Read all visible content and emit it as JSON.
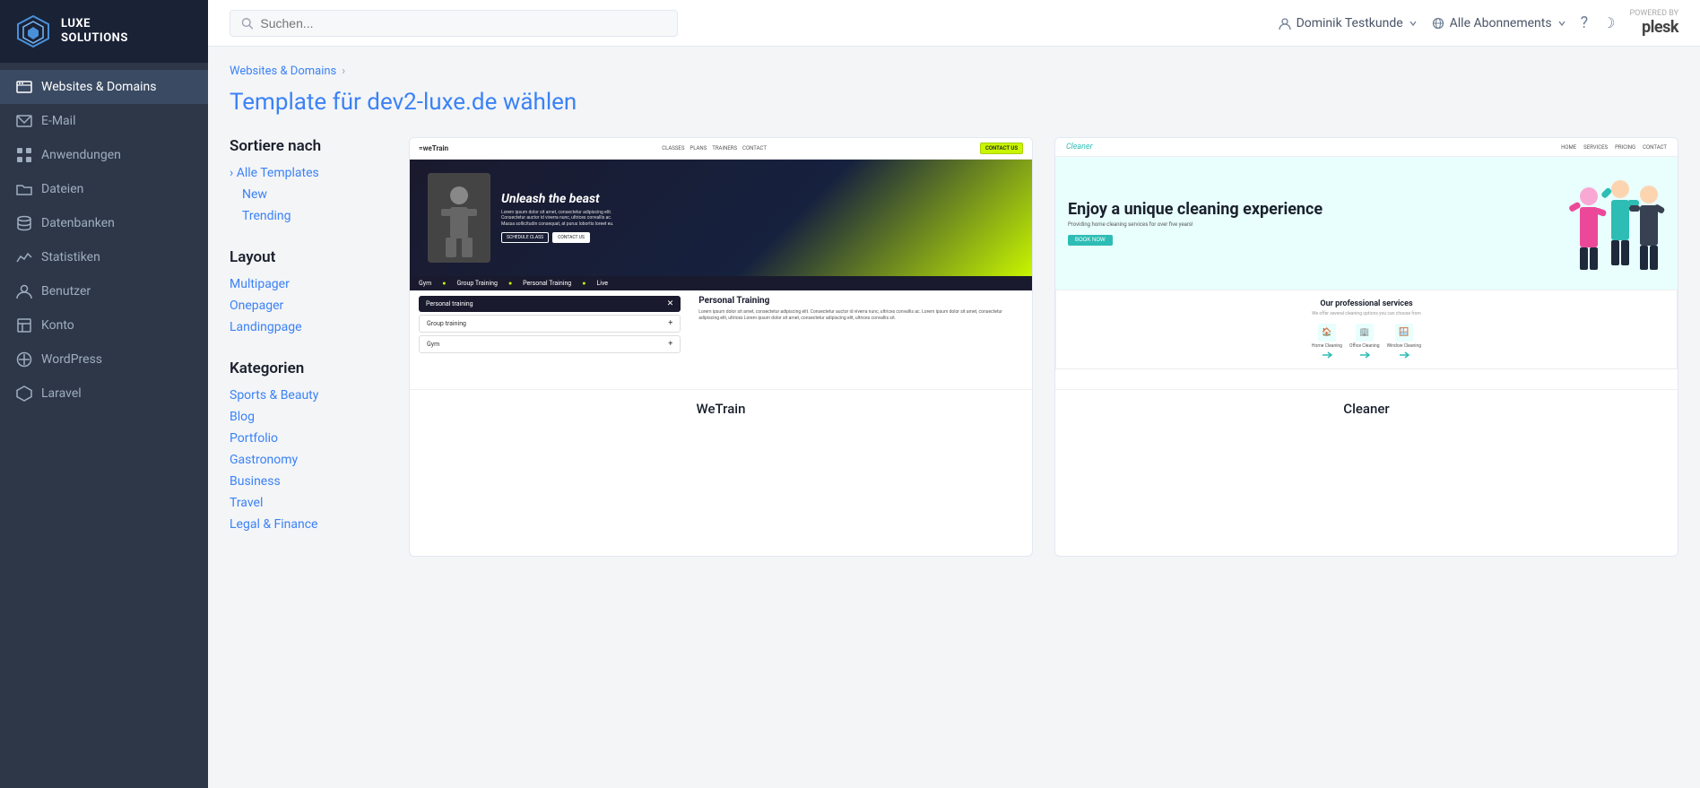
{
  "sidebar": {
    "logo_line1": "LUXE",
    "logo_line2": "SOLUTIONS",
    "items": [
      {
        "id": "websites",
        "label": "Websites & Domains",
        "icon": "globe",
        "active": true
      },
      {
        "id": "email",
        "label": "E-Mail",
        "icon": "envelope"
      },
      {
        "id": "applications",
        "label": "Anwendungen",
        "icon": "grid"
      },
      {
        "id": "files",
        "label": "Dateien",
        "icon": "folder"
      },
      {
        "id": "databases",
        "label": "Datenbanken",
        "icon": "database"
      },
      {
        "id": "statistics",
        "label": "Statistiken",
        "icon": "chart"
      },
      {
        "id": "users",
        "label": "Benutzer",
        "icon": "user"
      },
      {
        "id": "account",
        "label": "Konto",
        "icon": "building"
      },
      {
        "id": "wordpress",
        "label": "WordPress",
        "icon": "wordpress"
      },
      {
        "id": "laravel",
        "label": "Laravel",
        "icon": "laravel"
      }
    ]
  },
  "header": {
    "search_placeholder": "Suchen...",
    "user_name": "Dominik Testkunde",
    "subscription_label": "Alle Abonnements",
    "plesk_powered_by": "POWERED BY",
    "plesk_brand": "plesk"
  },
  "breadcrumb": {
    "parent": "Websites & Domains",
    "separator": "›"
  },
  "page": {
    "title_static": "Template für ",
    "title_domain": "dev2-luxe.de",
    "title_suffix": " wählen"
  },
  "filter": {
    "sort_title": "Sortiere nach",
    "all_templates_label": "Alle Templates",
    "new_label": "New",
    "trending_label": "Trending",
    "layout_title": "Layout",
    "layout_items": [
      "Multipager",
      "Onepager",
      "Landingpage"
    ],
    "categories_title": "Kategorien",
    "category_items": [
      "Sports & Beauty",
      "Blog",
      "Portfolio",
      "Gastronomy",
      "Business",
      "Travel",
      "Legal & Finance"
    ]
  },
  "templates": [
    {
      "id": "wetrain",
      "name": "WeTrain",
      "nav_logo": "=weTrain",
      "nav_links": [
        "CLASSES",
        "PLANS",
        "TRAINERS",
        "CONTACT"
      ],
      "nav_cta": "CONTACT US",
      "hero_title": "Unleash the beast",
      "hero_body": "Lorem ipsum dolor sit amet, consectetur adipiscing elit. Consectetur auctor id viverra nunc, ultrices convallis ac. Massa sollicitudin consequat, at purus lobortis loreet eu.",
      "hero_btn1": "SCHEDULE CLASS",
      "hero_btn2": "CONTACT US",
      "ticker_items": [
        "Gym",
        "Group Training",
        "Personal Training",
        "Live"
      ],
      "accordion_active": "Personal training",
      "accordion_items": [
        "Group training",
        "Gym"
      ],
      "right_title": "Personal Training",
      "right_body": "Lorem ipsum dolor sit amet, consectetur adipiscing elit. Consectetur auctor id viverra nunc, ultrices convallis ac. Lorem ipsum dolor sit amet, consectetur adipiscing elit, ultrices Lorem ipsum dolor sit amet, consectetur adipiscing elit, ultrices convallis sit."
    },
    {
      "id": "cleaner",
      "name": "Cleaner",
      "nav_logo": "Cleaner",
      "nav_links": [
        "HOME",
        "SERVICES",
        "PRICING",
        "CONTACT"
      ],
      "hero_title": "Enjoy a unique cleaning experience",
      "hero_sub": "Providing home cleaning services for over five years!",
      "hero_cta": "BOOK NOW",
      "services_title": "Our professional services",
      "services_sub": "We offer several cleaning options you can choose from",
      "services": [
        {
          "icon": "🏠",
          "name": "Home\nCleaning"
        },
        {
          "icon": "🏢",
          "name": "Office\nCleaning"
        },
        {
          "icon": "🪟",
          "name": "Window\nCleaning"
        }
      ]
    }
  ],
  "colors": {
    "sidebar_bg": "#2d3748",
    "sidebar_active": "#3a4a63",
    "sidebar_logo_bg": "#1a2236",
    "accent_blue": "#3b82f6",
    "wetrain_green": "#c8f500",
    "wetrain_dark": "#1a1a2e",
    "cleaner_teal": "#2dbdb4",
    "cleaner_bg": "#e8fffe"
  }
}
